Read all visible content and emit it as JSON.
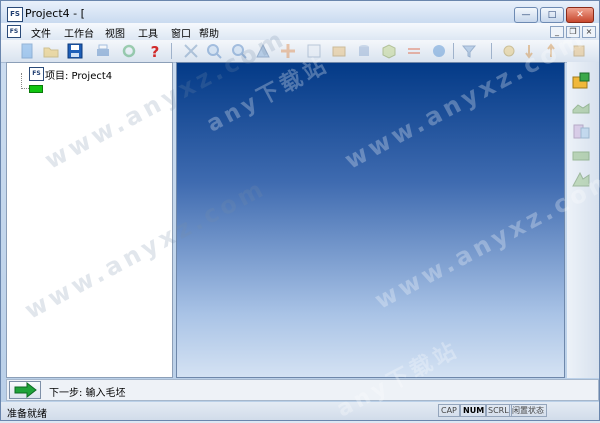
{
  "window": {
    "icon_text": "FS",
    "title": "Project4 - [",
    "minimize_symbol": "—",
    "maximize_symbol": "□",
    "close_symbol": "✕"
  },
  "menu": {
    "items": [
      "文件",
      "工作台",
      "视图",
      "工具",
      "窗口",
      "帮助"
    ],
    "mdi_minimize": "_",
    "mdi_restore": "❐",
    "mdi_close": "×"
  },
  "tree": {
    "root_label": "项目: Project4"
  },
  "step": {
    "text": "下一步: 输入毛坯"
  },
  "status": {
    "ready": "准备就绪",
    "indicators": [
      "CAP",
      "NUM",
      "SCRL",
      "闲置状态"
    ]
  },
  "watermark": {
    "url": "www.anyxz.com",
    "site": "any下载站"
  },
  "colors": {
    "viewport_top": "#033a87",
    "viewport_bottom": "#d4e2f3",
    "next_arrow": "#1fa33a"
  }
}
